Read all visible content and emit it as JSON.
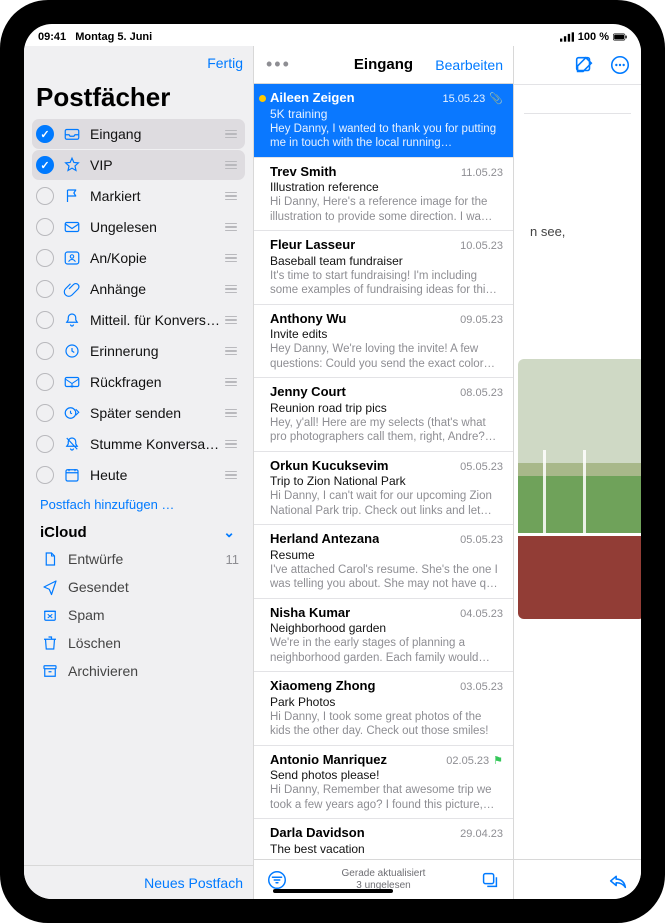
{
  "statusbar": {
    "time": "09:41",
    "date": "Montag 5. Juni",
    "signal_icon": "signal-icon",
    "battery_text": "100 %",
    "battery_icon": "battery-icon"
  },
  "mailboxes": {
    "done_label": "Fertig",
    "title": "Postfächer",
    "items": [
      {
        "icon": "inbox-tray-icon",
        "label": "Eingang",
        "checked": true,
        "selected": true
      },
      {
        "icon": "star-icon",
        "label": "VIP",
        "checked": true,
        "selected": true
      },
      {
        "icon": "flag-icon",
        "label": "Markiert",
        "checked": false
      },
      {
        "icon": "envelope-icon",
        "label": "Ungelesen",
        "checked": false
      },
      {
        "icon": "person-crop-icon",
        "label": "An/Kopie",
        "checked": false
      },
      {
        "icon": "paperclip-icon",
        "label": "Anhänge",
        "checked": false
      },
      {
        "icon": "bell-icon",
        "label": "Mitteil. für Konversa…",
        "checked": false
      },
      {
        "icon": "clock-icon",
        "label": "Erinnerung",
        "checked": false
      },
      {
        "icon": "envelope-arrow-icon",
        "label": "Rückfragen",
        "checked": false
      },
      {
        "icon": "clock-send-icon",
        "label": "Später senden",
        "checked": false
      },
      {
        "icon": "bell-slash-icon",
        "label": "Stumme Konversati…",
        "checked": false
      },
      {
        "icon": "calendar-icon",
        "label": "Heute",
        "checked": false
      }
    ],
    "add_label": "Postfach hinzufügen …",
    "section_label": "iCloud",
    "subitems": [
      {
        "icon": "doc-icon",
        "label": "Entwürfe",
        "count": "11"
      },
      {
        "icon": "paperplane-icon",
        "label": "Gesendet",
        "count": ""
      },
      {
        "icon": "xmark-bin-icon",
        "label": "Spam",
        "count": ""
      },
      {
        "icon": "trash-icon",
        "label": "Löschen",
        "count": ""
      },
      {
        "icon": "archivebox-icon",
        "label": "Archivieren",
        "count": ""
      }
    ],
    "footer_label": "Neues Postfach"
  },
  "list": {
    "title": "Eingang",
    "edit_label": "Bearbeiten",
    "messages": [
      {
        "from": "Aileen Zeigen",
        "date": "15.05.23",
        "subject": "5K training",
        "preview": "Hey Danny, I wanted to thank you for putting me in touch with the local running…",
        "selected": true,
        "unread": true,
        "attachment": true
      },
      {
        "from": "Trev Smith",
        "date": "11.05.23",
        "subject": "Illustration reference",
        "preview": "Hi Danny, Here's a reference image for the illustration to provide some direction. I wa…"
      },
      {
        "from": "Fleur Lasseur",
        "date": "10.05.23",
        "subject": "Baseball team fundraiser",
        "preview": "It's time to start fundraising! I'm including some examples of fundraising ideas for thi…"
      },
      {
        "from": "Anthony Wu",
        "date": "09.05.23",
        "subject": "Invite edits",
        "preview": "Hey Danny, We're loving the invite! A few questions: Could you send the exact color…"
      },
      {
        "from": "Jenny Court",
        "date": "08.05.23",
        "subject": "Reunion road trip pics",
        "preview": "Hey, y'all! Here are my selects (that's what pro photographers call them, right, Andre?…"
      },
      {
        "from": "Orkun Kucuksevim",
        "date": "05.05.23",
        "subject": "Trip to Zion National Park",
        "preview": "Hi Danny, I can't wait for our upcoming Zion National Park trip. Check out links and let…"
      },
      {
        "from": "Herland Antezana",
        "date": "05.05.23",
        "subject": "Resume",
        "preview": "I've attached Carol's resume. She's the one I was telling you about. She may not have q…"
      },
      {
        "from": "Nisha Kumar",
        "date": "04.05.23",
        "subject": "Neighborhood garden",
        "preview": "We're in the early stages of planning a neighborhood garden. Each family would…"
      },
      {
        "from": "Xiaomeng Zhong",
        "date": "03.05.23",
        "subject": "Park Photos",
        "preview": "Hi Danny, I took some great photos of the kids the other day. Check out those smiles!"
      },
      {
        "from": "Antonio Manriquez",
        "date": "02.05.23",
        "subject": "Send photos please!",
        "preview": "Hi Danny, Remember that awesome trip we took a few years ago? I found this picture,…",
        "flagged": true
      },
      {
        "from": "Darla Davidson",
        "date": "29.04.23",
        "subject": "The best vacation",
        "preview": ""
      }
    ],
    "footer_status_line1": "Gerade aktualisiert",
    "footer_status_line2": "3 ungelesen"
  },
  "detail": {
    "body_fragment": "n see,",
    "reply_icon": "reply-icon",
    "compose_icon": "compose-icon",
    "more_icon": "ellipsis-circle-icon"
  }
}
